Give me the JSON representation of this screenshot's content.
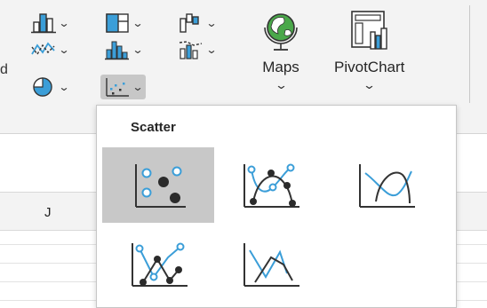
{
  "ribbon": {
    "truncated_text": "d",
    "groups": {
      "maps": {
        "label": "Maps"
      },
      "pivotchart": {
        "label": "PivotChart"
      }
    },
    "chevron": "⌄"
  },
  "sheet": {
    "column_label": "J"
  },
  "scatter_menu": {
    "title": "Scatter",
    "options": [
      {
        "icon": "scatter-markers-icon",
        "selected": true
      },
      {
        "icon": "scatter-smooth-lines-markers-icon",
        "selected": false
      },
      {
        "icon": "scatter-smooth-lines-icon",
        "selected": false
      },
      {
        "icon": "scatter-straight-lines-markers-icon",
        "selected": false
      },
      {
        "icon": "scatter-straight-lines-icon",
        "selected": false
      }
    ]
  },
  "colors": {
    "accent_blue": "#3b9ed8",
    "dark": "#2b2b2b",
    "green": "#4aa84a",
    "selected_bg": "#c8c8c8"
  }
}
